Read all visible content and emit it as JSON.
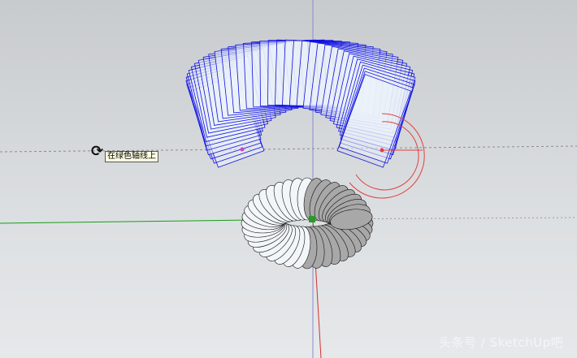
{
  "viewport": {
    "tooltip": "在绿色轴线上",
    "cursor_icon": "orbit-icon",
    "watermark": "头条号 / SketchUp吧"
  },
  "colors": {
    "green_axis": "#1a9a1a",
    "red_axis": "#d23030",
    "blue_axis": "#5050d0",
    "wireframe": "#1010e0",
    "protractor": "#e04040"
  }
}
